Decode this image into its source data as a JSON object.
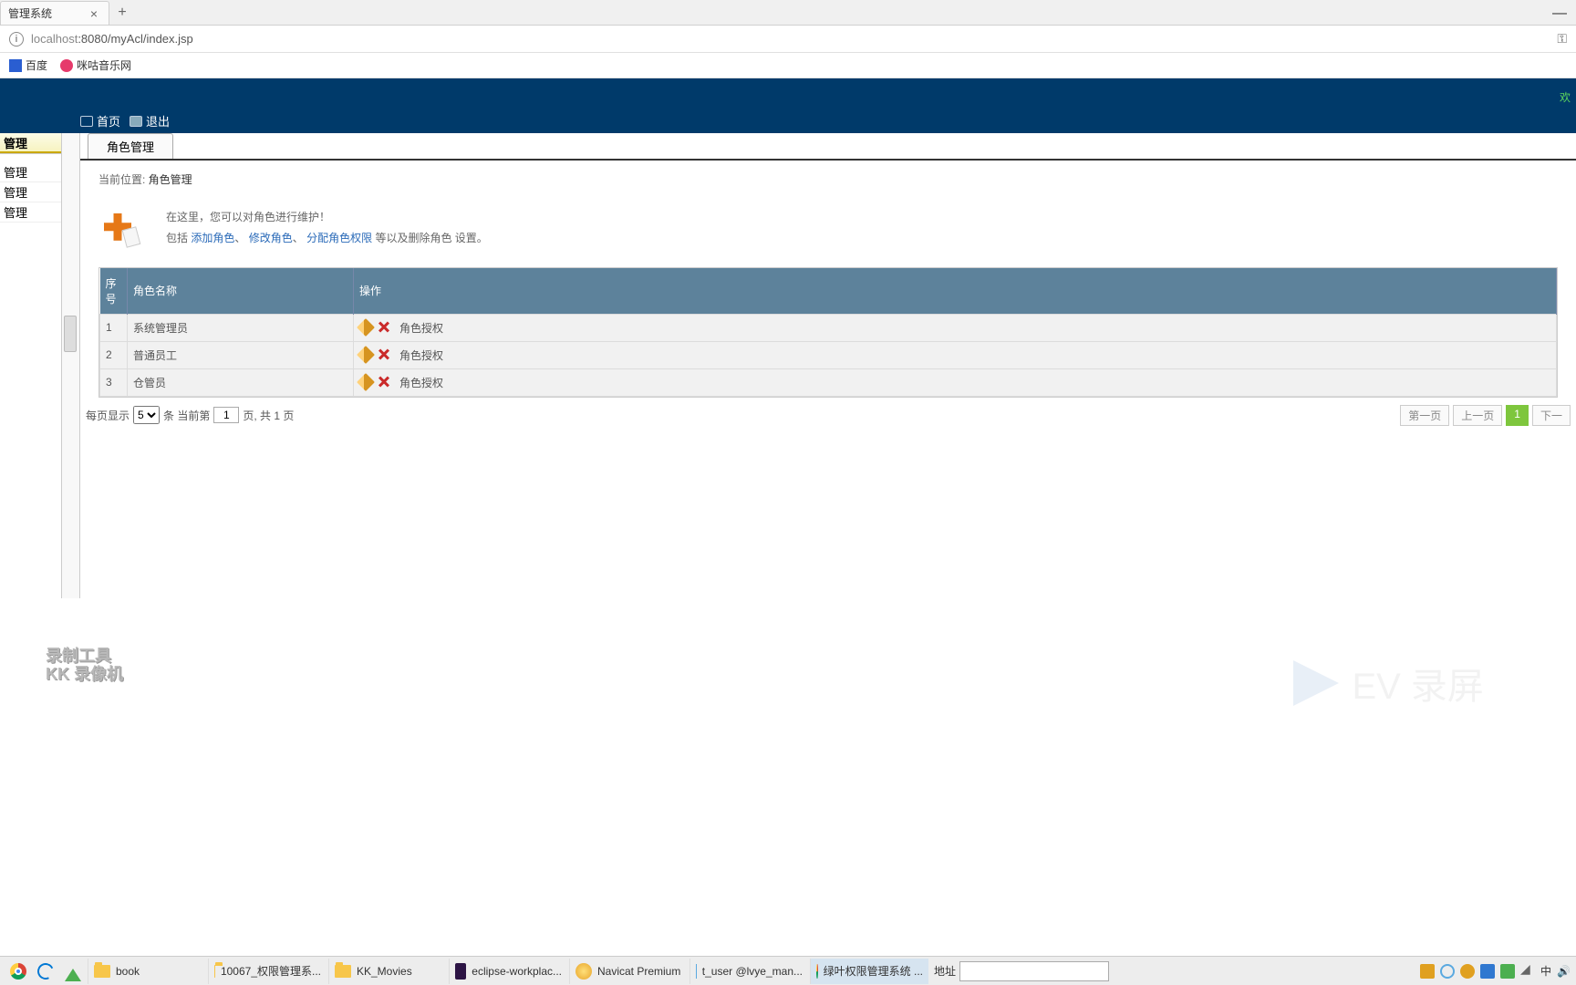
{
  "browser": {
    "tab_title": "管理系统",
    "url_dim": "localhost",
    "url_rest": ":8080/myAcl/index.jsp",
    "bookmarks": {
      "baidu": "百度",
      "music": "咪咕音乐网"
    }
  },
  "header": {
    "welcome": "欢",
    "nav_home": "首页",
    "nav_exit": "退出"
  },
  "sidebar": {
    "item_active": "管理",
    "item1": "管理",
    "item2": "管理",
    "item3": "管理"
  },
  "content": {
    "tab_label": "角色管理",
    "breadcrumb_prefix": "当前位置: ",
    "breadcrumb_loc": "角色管理",
    "intro_line1": "在这里，您可以对角色进行维护！",
    "intro_prefix": "包括 ",
    "link_add": "添加角色",
    "link_edit": "修改角色",
    "link_perm": "分配角色权限",
    "intro_suffix": " 等以及删除角色 设置。",
    "sep": "、"
  },
  "table": {
    "col_seq": "序号",
    "col_name": "角色名称",
    "col_op": "操作",
    "perm_label": "角色授权",
    "rows": [
      {
        "seq": "1",
        "name": "系统管理员"
      },
      {
        "seq": "2",
        "name": "普通员工"
      },
      {
        "seq": "3",
        "name": "仓管员"
      }
    ]
  },
  "pager": {
    "per_page_prefix": "每页显示",
    "per_page_value": "5",
    "records_label": "条 当前第",
    "current_page": "1",
    "page_info": "页, 共 1 页",
    "first": "第一页",
    "prev": "上一页",
    "p1": "1",
    "next": "下一"
  },
  "watermark": {
    "kk_line1": "录制工具",
    "kk_line2": "KK 录像机",
    "ev": "EV 录屏"
  },
  "taskbar": {
    "book": "book",
    "proj": "10067_权限管理系...",
    "kk": "KK_Movies",
    "eclipse": "eclipse-workplac...",
    "navicat": "Navicat Premium",
    "tuser": "t_user @lvye_man...",
    "lvye": "绿叶权限管理系统 ...",
    "addr_label": "地址",
    "ime": "中"
  }
}
